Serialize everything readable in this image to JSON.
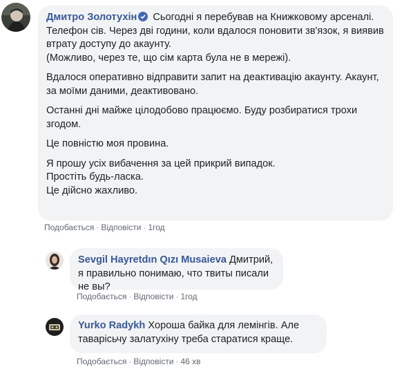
{
  "comments": [
    {
      "author": "Дмитро Золотухін",
      "verified": true,
      "paragraphs": [
        "Сьогодні я перебував на Книжковому арсеналі. Телефон сів. Через дві години, коли вдалося поновити зв'язок, я виявив втрату доступу до акаунту.\n(Можливо, через те, що сім карта була не в мережі).",
        "Вдалося оперативно відправити запит на деактивацію акаунту. Акаунт, за моїми даними, деактивовано.",
        "Останні дні майже цілодобово працюємо. Буду розбиратися трохи згодом.",
        "Це повністю моя провина.",
        "Я прошу усіх вибачення за цей прикрий випадок.\nПростіть будь-ласка.\nЦе дійсно жахливо."
      ],
      "like_label": "Подобається",
      "reply_label": "Відповісти",
      "time": "1год"
    },
    {
      "author": "Sevgil Hayretdın Qızı Musaieva",
      "text": "Дмитрий, я правильно понимаю, что твиты писали не вы?",
      "like_label": "Подобається",
      "reply_label": "Відповісти",
      "time": "1год"
    },
    {
      "author": "Yurko Radykh",
      "text": "Хороша байка для лемінгів. Але таварісьчу залатухіну треба старатися краще.",
      "like_label": "Подобається",
      "reply_label": "Відповісти",
      "time": "46 хв"
    }
  ],
  "separator": "·",
  "colors": {
    "author_link": "#385898",
    "bubble_bg": "#f2f3f5",
    "meta_gray": "#90949c",
    "verified_badge": "#4267b2"
  },
  "icons": {
    "verified": "verified-badge-icon",
    "avatars": [
      "avatar-photo",
      "avatar-photo",
      "avatar-photo"
    ]
  }
}
